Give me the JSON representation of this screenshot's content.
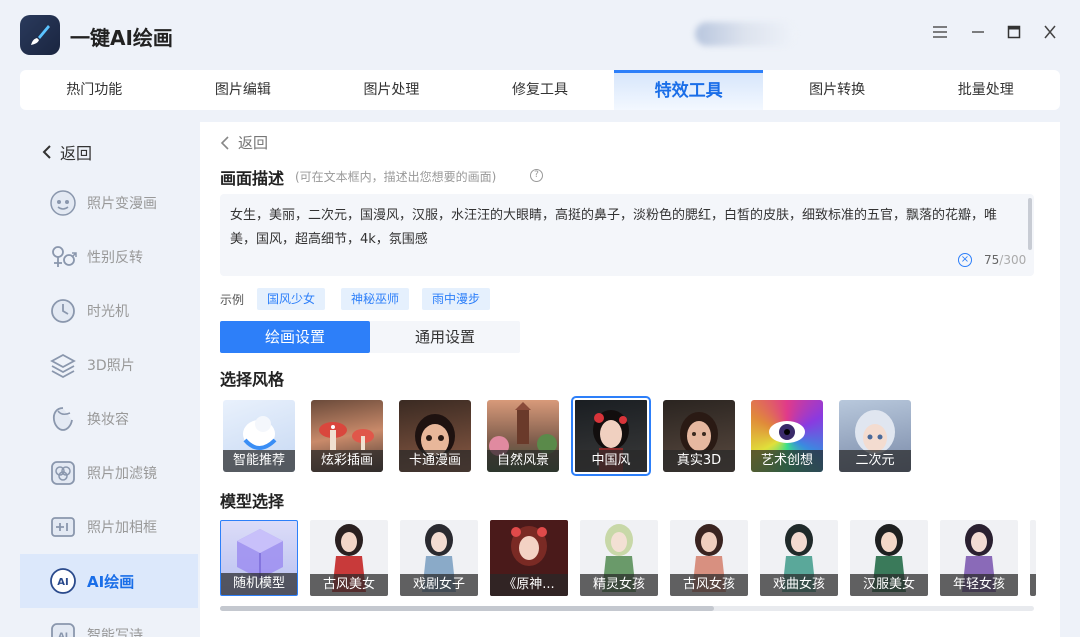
{
  "app": {
    "title": "一键AI绘画"
  },
  "window_controls": [
    "≡",
    "−",
    "□",
    "×"
  ],
  "topnav": [
    {
      "label": "热门功能"
    },
    {
      "label": "图片编辑"
    },
    {
      "label": "图片处理"
    },
    {
      "label": "修复工具"
    },
    {
      "label": "特效工具",
      "active": true
    },
    {
      "label": "图片转换"
    },
    {
      "label": "批量处理"
    }
  ],
  "sidebar": {
    "back_label": "返回",
    "items": [
      {
        "label": "照片变漫画",
        "icon": "cartoon-face-icon"
      },
      {
        "label": "性别反转",
        "icon": "gender-icon"
      },
      {
        "label": "时光机",
        "icon": "clock-icon"
      },
      {
        "label": "3D照片",
        "icon": "layers-icon"
      },
      {
        "label": "换妆容",
        "icon": "makeup-icon"
      },
      {
        "label": "照片加滤镜",
        "icon": "filter-icon"
      },
      {
        "label": "照片加相框",
        "icon": "frame-icon"
      },
      {
        "label": "AI绘画",
        "icon": "ai-paint-icon",
        "active": true
      },
      {
        "label": "智能写诗",
        "icon": "ai-poem-icon"
      }
    ]
  },
  "main": {
    "back_label": "返回",
    "desc_title": "画面描述",
    "desc_hint": "(可在文本框内，描述出您想要的画面)",
    "desc_text": "女生，美丽，二次元，国漫风，汉服，水汪汪的大眼睛，高挺的鼻子，淡粉色的腮红，白皙的皮肤，细致标准的五官，飘落的花瓣，唯美，国风，超高细节，4k，氛围感",
    "desc_count": "75",
    "desc_max": "/300",
    "example_label": "示例",
    "examples": [
      "国风少女",
      "神秘巫师",
      "雨中漫步"
    ],
    "settings_tabs": [
      "绘画设置",
      "通用设置"
    ],
    "style_title": "选择风格",
    "styles": [
      "智能推荐",
      "炫彩插画",
      "卡通漫画",
      "自然风景",
      "中国风",
      "真实3D",
      "艺术创想",
      "二次元"
    ],
    "selected_style": "中国风",
    "model_title": "模型选择",
    "models": [
      "随机模型",
      "古风美女",
      "戏剧女子",
      "《原神...",
      "精灵女孩",
      "古风女孩",
      "戏曲女孩",
      "汉服美女",
      "年轻女孩"
    ],
    "selected_model": "随机模型"
  }
}
